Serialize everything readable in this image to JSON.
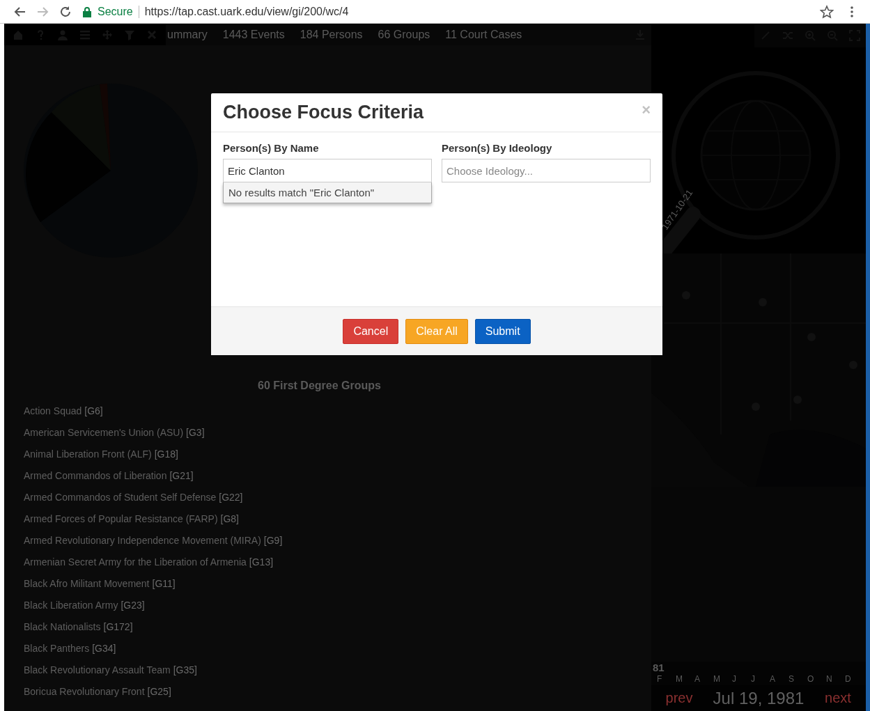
{
  "browser": {
    "secure_label": "Secure",
    "url": "https://tap.cast.uark.edu/view/gi/200/wc/4"
  },
  "app_tabs": [
    {
      "label": "ummary"
    },
    {
      "label": "1443 Events"
    },
    {
      "label": "184 Persons"
    },
    {
      "label": "66 Groups"
    },
    {
      "label": "11 Court Cases"
    }
  ],
  "groups": {
    "title": "60 First Degree Groups",
    "items": [
      {
        "name": "Action Squad",
        "code": "[G6]"
      },
      {
        "name": "American Servicemen's Union (ASU)",
        "code": "[G3]"
      },
      {
        "name": "Animal Liberation Front (ALF)",
        "code": "[G18]"
      },
      {
        "name": "Armed Commandos of Liberation",
        "code": "[G21]"
      },
      {
        "name": "Armed Commandos of Student Self Defense",
        "code": "[G22]"
      },
      {
        "name": "Armed Forces of Popular Resistance (FARP)",
        "code": "[G8]"
      },
      {
        "name": "Armed Revolutionary Independence Movement (MIRA)",
        "code": "[G9]"
      },
      {
        "name": "Armenian Secret Army for the Liberation of Armenia",
        "code": "[G13]"
      },
      {
        "name": "Black Afro Militant Movement",
        "code": "[G11]"
      },
      {
        "name": "Black Liberation Army",
        "code": "[G23]"
      },
      {
        "name": "Black Nationalists",
        "code": "[G172]"
      },
      {
        "name": "Black Panthers",
        "code": "[G34]"
      },
      {
        "name": "Black Revolutionary Assault Team",
        "code": "[G35]"
      },
      {
        "name": "Boricua Revolutionary Front",
        "code": "[G25]"
      }
    ]
  },
  "globe": {
    "date_label": "1971-10-21"
  },
  "timeline": {
    "year": "81",
    "months": [
      "F",
      "M",
      "A",
      "M",
      "J",
      "J",
      "A",
      "S",
      "O",
      "N",
      "D"
    ],
    "prev": "prev",
    "date": "Jul 19, 1981",
    "next": "next"
  },
  "modal": {
    "title": "Choose Focus Criteria",
    "close": "×",
    "fields": [
      {
        "label": "Person(s) By Name",
        "value": "Eric Clanton",
        "dropdown": "No results match \"Eric Clanton\""
      },
      {
        "label": "Person(s) By Ideology",
        "placeholder": "Choose Ideology..."
      }
    ],
    "buttons": [
      {
        "label": "Cancel",
        "kind": "danger"
      },
      {
        "label": "Clear All",
        "kind": "warning"
      },
      {
        "label": "Submit",
        "kind": "primary"
      }
    ]
  }
}
